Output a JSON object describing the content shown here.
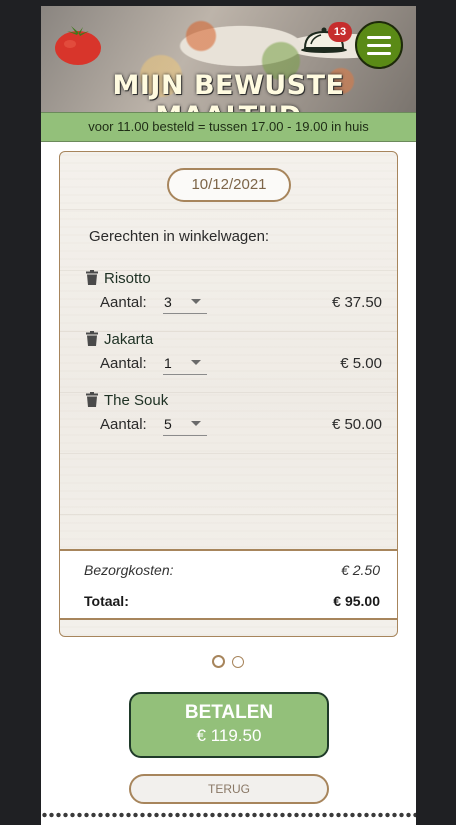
{
  "header": {
    "brand": "MIJN BEWUSTE MAALTIJD",
    "cart_count": "13",
    "icons": {
      "logo": "tomato-icon",
      "cart": "cloche-icon",
      "menu": "hamburger-menu-icon"
    }
  },
  "delivery_info": "voor 11.00 besteld = tussen 17.00 - 19.00 in huis",
  "order": {
    "date": "10/12/2021",
    "cart_heading": "Gerechten in winkelwagen:",
    "quantity_label": "Aantal:",
    "items": [
      {
        "name": "Risotto",
        "quantity": "3",
        "price": "€ 37.50"
      },
      {
        "name": "Jakarta",
        "quantity": "1",
        "price": "€ 5.00"
      },
      {
        "name": "The Souk",
        "quantity": "5",
        "price": "€ 50.00"
      }
    ],
    "delivery_costs_label": "Bezorgkosten:",
    "delivery_costs": "€ 2.50",
    "total_label": "Totaal:",
    "total": "€ 95.00"
  },
  "pagination": {
    "pages": 2,
    "active": 1
  },
  "actions": {
    "pay_label": "BETALEN",
    "pay_amount": "€ 119.50",
    "back_label": "TERUG"
  },
  "colors": {
    "accent_green": "#93c07a",
    "brand_green": "#5a8a16",
    "border_brown": "#a7855c",
    "badge_red": "#c62d2d"
  }
}
